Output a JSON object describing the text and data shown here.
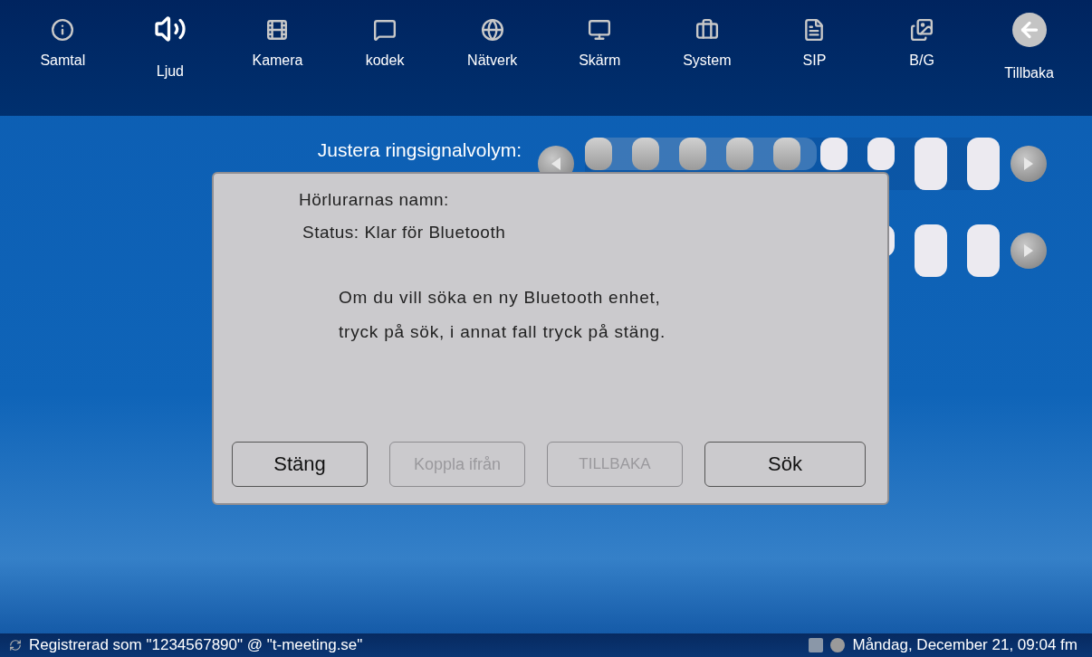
{
  "nav": [
    {
      "label": "Samtal",
      "selected": false
    },
    {
      "label": "Ljud",
      "selected": true
    },
    {
      "label": "Kamera",
      "selected": false
    },
    {
      "label": "kodek",
      "selected": false
    },
    {
      "label": "Nätverk",
      "selected": false
    },
    {
      "label": "Skärm",
      "selected": false
    },
    {
      "label": "System",
      "selected": false
    },
    {
      "label": "SIP",
      "selected": false
    },
    {
      "label": "B/G",
      "selected": false
    }
  ],
  "back_button": {
    "label": "Tillbaka"
  },
  "settings": [
    {
      "kind": "slider",
      "label": "Justera ringsignalvolym:",
      "level": 0.56
    },
    {
      "kind": "covered"
    }
  ],
  "dialog": {
    "lines": [
      "Hörlurarnas namn:",
      "Status: Klar för Bluetooth"
    ],
    "message": [
      "Om du vill söka en ny Bluetooth enhet,",
      "tryck på sök, i annat fall tryck på stäng."
    ],
    "buttons": [
      {
        "label": "Stäng",
        "disabled": false
      },
      {
        "label": "Koppla ifrån",
        "disabled": true
      },
      {
        "label": "TILLBAKA",
        "disabled": true
      },
      {
        "label": "Sök",
        "disabled": false
      }
    ]
  },
  "status_bar": {
    "registration": "Registrerad som \"1234567890\" @ \"t-meeting.se\"",
    "datetime": "Måndag, December 21, 09:04 fm"
  }
}
